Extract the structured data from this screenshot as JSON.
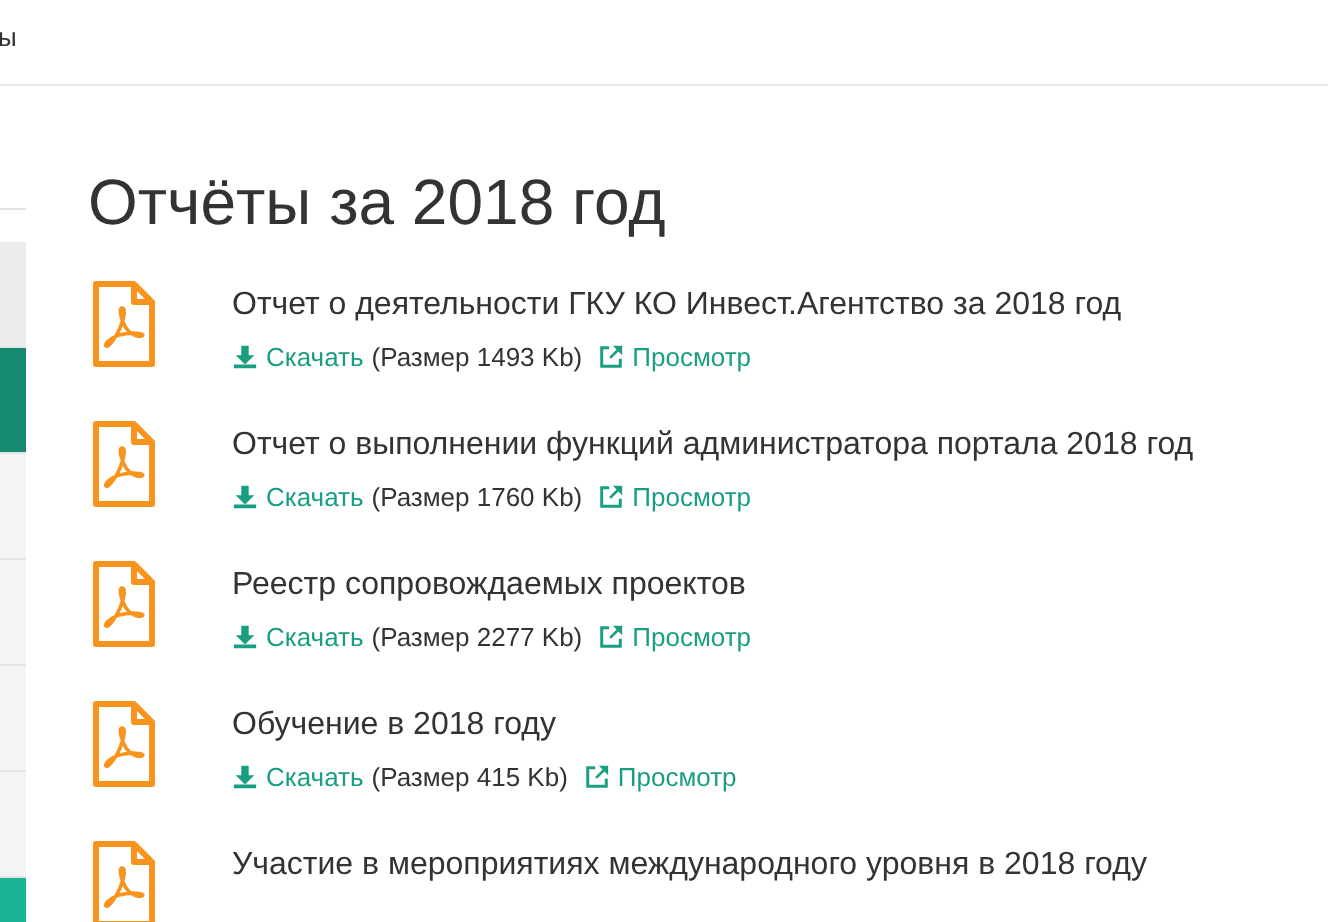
{
  "top_nav": {
    "items": [
      "ы"
    ]
  },
  "sidebar": {
    "items": [
      {
        "kind": "item",
        "selected": false
      },
      {
        "kind": "item",
        "selected": true
      },
      {
        "kind": "item",
        "selected": false
      },
      {
        "kind": "item",
        "selected": false
      },
      {
        "kind": "item",
        "selected": false
      },
      {
        "kind": "item",
        "selected": false
      },
      {
        "kind": "button",
        "selected": false
      }
    ]
  },
  "heading": "Отчёты за 2018 год",
  "documents": [
    {
      "title": "Отчет о деятельности ГКУ КО Инвест.Агентство за 2018 год",
      "download": "Скачать",
      "size": "(Размер 1493 Kb)",
      "view": "Просмотр"
    },
    {
      "title": "Отчет о выполнении функций администратора портала 2018 год",
      "download": "Скачать",
      "size": "(Размер 1760 Kb)",
      "view": "Просмотр"
    },
    {
      "title": "Реестр сопровождаемых проектов",
      "download": "Скачать",
      "size": "(Размер 2277 Kb)",
      "view": "Просмотр"
    },
    {
      "title": "Обучение в 2018 году",
      "download": "Скачать",
      "size": "(Размер 415 Kb)",
      "view": "Просмотр"
    },
    {
      "title": "Участие в мероприятиях международного уровня в 2018 году"
    }
  ]
}
